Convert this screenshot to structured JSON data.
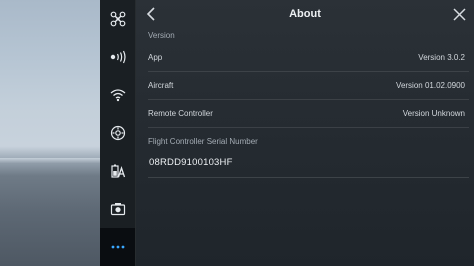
{
  "panel": {
    "title": "About"
  },
  "version_section": {
    "label": "Version",
    "rows": [
      {
        "label": "App",
        "value": "Version 3.0.2"
      },
      {
        "label": "Aircraft",
        "value": "Version 01.02.0900"
      },
      {
        "label": "Remote Controller",
        "value": "Version Unknown"
      }
    ]
  },
  "serial_section": {
    "label": "Flight Controller Serial Number",
    "value": "08RDD9100103HF"
  },
  "sidebar": {
    "items": [
      {
        "icon": "drone-icon"
      },
      {
        "icon": "aircraft-signal-icon"
      },
      {
        "icon": "wifi-icon"
      },
      {
        "icon": "gimbal-joystick-icon"
      },
      {
        "icon": "battery-auto-icon"
      },
      {
        "icon": "camera-icon"
      },
      {
        "icon": "more-icon",
        "active": true
      }
    ]
  },
  "colors": {
    "panel_bg": "#262c32",
    "sidebar_bg": "#1a1e23",
    "active_dots": "#3aa7ff",
    "text": "#d2d7dc"
  }
}
